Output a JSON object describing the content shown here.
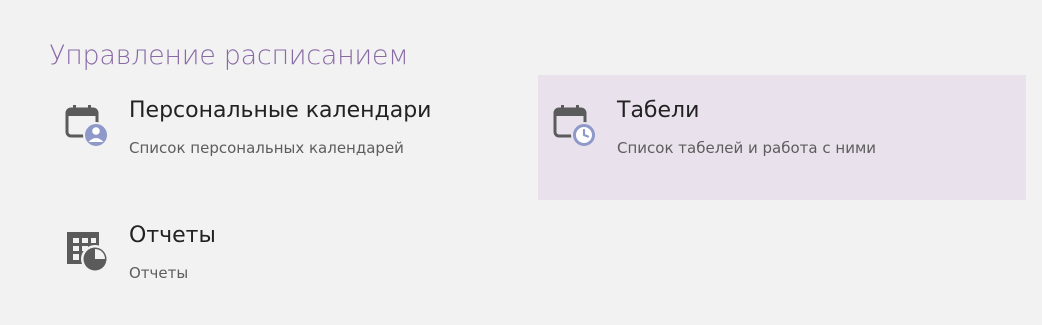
{
  "section": {
    "title": "Управление расписанием"
  },
  "tiles": [
    {
      "title": "Персональные календари",
      "description": "Список персональных календарей",
      "icon": "calendar-user-icon"
    },
    {
      "title": "Табели",
      "description": "Список табелей и работа с ними",
      "icon": "calendar-clock-icon"
    },
    {
      "title": "Отчеты",
      "description": "Отчеты",
      "icon": "table-chart-icon"
    }
  ],
  "colors": {
    "background": "#f2f2f2",
    "accent": "#8a6aa6",
    "highlight": "#e9e1ec",
    "icon_gray": "#5b5b5b",
    "icon_blue": "#8e99c9"
  }
}
